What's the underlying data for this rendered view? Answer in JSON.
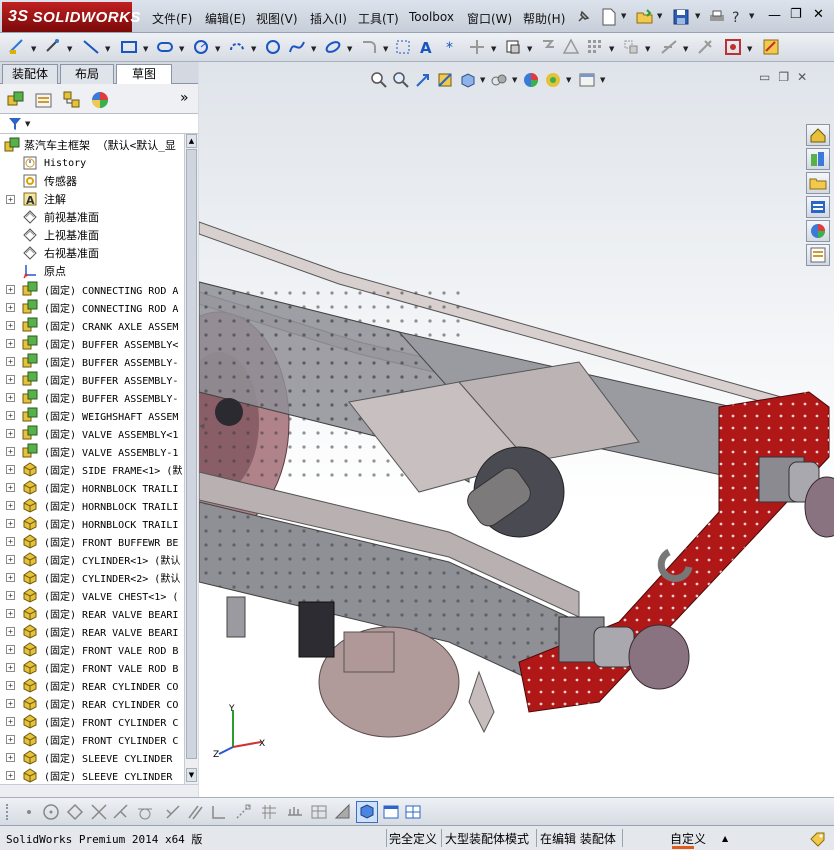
{
  "app": {
    "logo_prefix": "3S",
    "logo_text": "SOLIDWORKS"
  },
  "menu": {
    "items": [
      {
        "label": "文件(F)"
      },
      {
        "label": "编辑(E)"
      },
      {
        "label": "视图(V)"
      },
      {
        "label": "插入(I)"
      },
      {
        "label": "工具(T)"
      },
      {
        "label": "Toolbox"
      },
      {
        "label": "窗口(W)"
      },
      {
        "label": "帮助(H)"
      }
    ]
  },
  "window_controls": {
    "minimize": "—",
    "restore": "❐",
    "close": "✕"
  },
  "panel": {
    "tabs": [
      {
        "label": "装配体"
      },
      {
        "label": "布局"
      },
      {
        "label": "草图"
      }
    ],
    "active_tab": "草图",
    "expand_arrows": "»",
    "root_label": "蒸汽车主框架 （默认<默认_显"
  },
  "tree": {
    "items": [
      {
        "label": "History",
        "icon": "history-icon",
        "expand": false,
        "mono": true
      },
      {
        "label": "传感器",
        "icon": "sensor-icon",
        "expand": false,
        "mono": false
      },
      {
        "label": "注解",
        "icon": "annotation-icon",
        "expand": true,
        "mono": false
      },
      {
        "label": "前视基准面",
        "icon": "plane-icon",
        "expand": false,
        "mono": false
      },
      {
        "label": "上视基准面",
        "icon": "plane-icon",
        "expand": false,
        "mono": false
      },
      {
        "label": "右视基准面",
        "icon": "plane-icon",
        "expand": false,
        "mono": false
      },
      {
        "label": "原点",
        "icon": "origin-icon",
        "expand": false,
        "mono": false
      },
      {
        "label": "(固定) CONNECTING ROD A",
        "icon": "assembly-icon",
        "expand": true,
        "mono": true
      },
      {
        "label": "(固定) CONNECTING ROD A",
        "icon": "assembly-icon",
        "expand": true,
        "mono": true
      },
      {
        "label": "(固定) CRANK AXLE ASSEM",
        "icon": "assembly-icon",
        "expand": true,
        "mono": true
      },
      {
        "label": "(固定) BUFFER ASSEMBLY<",
        "icon": "assembly-icon",
        "expand": true,
        "mono": true
      },
      {
        "label": "(固定) BUFFER ASSEMBLY-",
        "icon": "assembly-icon",
        "expand": true,
        "mono": true
      },
      {
        "label": "(固定) BUFFER ASSEMBLY-",
        "icon": "assembly-icon",
        "expand": true,
        "mono": true
      },
      {
        "label": "(固定) BUFFER ASSEMBLY-",
        "icon": "assembly-icon",
        "expand": true,
        "mono": true
      },
      {
        "label": "(固定) WEIGHSHAFT ASSEM",
        "icon": "assembly-icon",
        "expand": true,
        "mono": true
      },
      {
        "label": "(固定) VALVE ASSEMBLY<1",
        "icon": "assembly-icon",
        "expand": true,
        "mono": true
      },
      {
        "label": "(固定) VALVE ASSEMBLY-1",
        "icon": "assembly-icon",
        "expand": true,
        "mono": true
      },
      {
        "label": "(固定) SIDE FRAME<1> (默",
        "icon": "part-icon",
        "expand": true,
        "mono": true
      },
      {
        "label": "(固定) HORNBLOCK TRAILI",
        "icon": "part-icon",
        "expand": true,
        "mono": true
      },
      {
        "label": "(固定) HORNBLOCK TRAILI",
        "icon": "part-icon",
        "expand": true,
        "mono": true
      },
      {
        "label": "(固定) HORNBLOCK TRAILI",
        "icon": "part-icon",
        "expand": true,
        "mono": true
      },
      {
        "label": "(固定) FRONT BUFFEWR BE",
        "icon": "part-icon",
        "expand": true,
        "mono": true
      },
      {
        "label": "(固定) CYLINDER<1> (默认",
        "icon": "part-icon",
        "expand": true,
        "mono": true
      },
      {
        "label": "(固定) CYLINDER<2> (默认",
        "icon": "part-icon",
        "expand": true,
        "mono": true
      },
      {
        "label": "(固定) VALVE CHEST<1> (",
        "icon": "part-icon",
        "expand": true,
        "mono": true
      },
      {
        "label": "(固定) REAR VALVE BEARI",
        "icon": "part-icon",
        "expand": true,
        "mono": true
      },
      {
        "label": "(固定) REAR VALVE BEARI",
        "icon": "part-icon",
        "expand": true,
        "mono": true
      },
      {
        "label": "(固定) FRONT VALE ROD B",
        "icon": "part-icon",
        "expand": true,
        "mono": true
      },
      {
        "label": "(固定) FRONT VALE ROD B",
        "icon": "part-icon",
        "expand": true,
        "mono": true
      },
      {
        "label": "(固定) REAR CYLINDER CO",
        "icon": "part-icon",
        "expand": true,
        "mono": true
      },
      {
        "label": "(固定) REAR CYLINDER CO",
        "icon": "part-icon",
        "expand": true,
        "mono": true
      },
      {
        "label": "(固定) FRONT CYLINDER C",
        "icon": "part-icon",
        "expand": true,
        "mono": true
      },
      {
        "label": "(固定) FRONT CYLINDER C",
        "icon": "part-icon",
        "expand": true,
        "mono": true
      },
      {
        "label": "(固定) SLEEVE CYLINDER",
        "icon": "part-icon",
        "expand": true,
        "mono": true
      },
      {
        "label": "(固定) SLEEVE CYLINDER",
        "icon": "part-icon",
        "expand": true,
        "mono": true
      }
    ]
  },
  "viewport": {
    "triad_labels": {
      "x": "X",
      "y": "Y",
      "z": "Z"
    },
    "colors": {
      "frame": "#8f8f96",
      "buffer_beam": "#b01818",
      "wheel": "#b0838a",
      "buffer_head": "#8a7380"
    }
  },
  "status": {
    "product": "SolidWorks Premium 2014 x64 版",
    "definition": "完全定义",
    "mode": "大型装配体模式",
    "editing": "在编辑 装配体",
    "units": "自定义",
    "units_arrow": "▲"
  }
}
